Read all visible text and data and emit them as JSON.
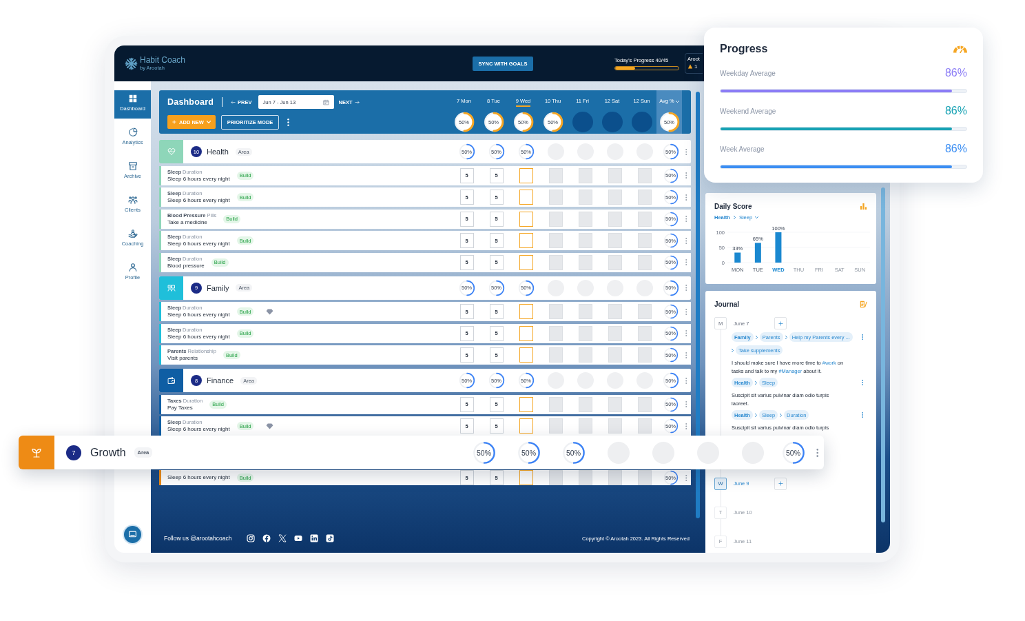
{
  "topbar": {
    "app_name": "Habit Coach",
    "byline": "by Arootah",
    "sync_button": "SYNC WITH GOALS",
    "today_progress": {
      "label": "Today’s Progress 40/45",
      "level": 0.32
    },
    "user": {
      "name": "Aroot",
      "count": "1"
    }
  },
  "sidebar": {
    "items": [
      {
        "label": "Dashboard",
        "selected": true
      },
      {
        "label": "Analytics",
        "selected": false
      },
      {
        "label": "Archive",
        "selected": false
      },
      {
        "label": "Clients",
        "selected": false
      },
      {
        "label": "Coaching",
        "selected": false
      },
      {
        "label": "Profile",
        "selected": false
      }
    ]
  },
  "board": {
    "title": "Dashboard",
    "prev": "PREV",
    "date_range": "Jun 7 - Jun 13",
    "next": "NEXT",
    "add_button": "ADD NEW",
    "mode_button": "PRIORITIZE MODE",
    "days": [
      {
        "label": "7 Mon",
        "selected": false,
        "future": false,
        "ring": {
          "label": "50%",
          "level": 0.5
        }
      },
      {
        "label": "8 Tue",
        "selected": false,
        "future": false,
        "ring": {
          "label": "50%",
          "level": 0.5
        }
      },
      {
        "label": "9 Wed",
        "selected": true,
        "future": false,
        "ring": {
          "label": "50%",
          "level": 0.5
        }
      },
      {
        "label": "10 Thu",
        "selected": false,
        "future": false,
        "ring": {
          "label": "50%",
          "level": 0.5
        }
      },
      {
        "label": "11 Fri",
        "selected": false,
        "future": true
      },
      {
        "label": "12 Sat",
        "selected": false,
        "future": true
      },
      {
        "label": "12 Sun",
        "selected": false,
        "future": true
      }
    ],
    "avg": {
      "label": "Avg %",
      "ring": {
        "label": "50%",
        "level": 0.5
      }
    }
  },
  "areas": [
    {
      "name": "Health",
      "count": "10",
      "tag": "Area",
      "color": "#8ed6b9",
      "popped_out": false,
      "rings": [
        {
          "label": "50%",
          "level": 0.5
        },
        {
          "label": "50%",
          "level": 0.5
        },
        {
          "label": "50%",
          "level": 0.5
        }
      ],
      "avg": {
        "label": "50%",
        "level": 0.5
      },
      "habits": [
        {
          "label": "**Sleep** Duration",
          "title": "Sleep 6 hours every night",
          "tag": "Build",
          "gem": false,
          "values": [
            "5",
            "5"
          ],
          "avg": {
            "label": "50%",
            "level": 0.5
          }
        },
        {
          "label": "**Sleep** Duration",
          "title": "Sleep 6 hours every night",
          "tag": "Build",
          "gem": false,
          "values": [
            "5",
            "5"
          ],
          "avg": {
            "label": "50%",
            "level": 0.5
          }
        },
        {
          "label": "**Blood Pressure** Pills",
          "title": "Take a medicine",
          "tag": "Build",
          "gem": false,
          "values": [
            "5",
            "5"
          ],
          "avg": {
            "label": "50%",
            "level": 0.5
          }
        },
        {
          "label": "**Sleep** Duration",
          "title": "Sleep 6 hours every night",
          "tag": "Build",
          "gem": false,
          "values": [
            "5",
            "5"
          ],
          "avg": {
            "label": "50%",
            "level": 0.5
          }
        },
        {
          "label": "**Sleep** Duration",
          "title": "Blood pressure",
          "tag": "Build",
          "gem": false,
          "values": [
            "5",
            "5"
          ],
          "avg": {
            "label": "50%",
            "level": 0.5
          }
        }
      ]
    },
    {
      "name": "Family",
      "count": "9",
      "tag": "Area",
      "color": "#1fbfda",
      "popped_out": false,
      "rings": [
        {
          "label": "50%",
          "level": 0.5
        },
        {
          "label": "50%",
          "level": 0.5
        },
        {
          "label": "50%",
          "level": 0.5
        }
      ],
      "avg": {
        "label": "50%",
        "level": 0.5
      },
      "habits": [
        {
          "label": "**Sleep** Duration",
          "title": "Sleep 6 hours every night",
          "tag": "Build",
          "gem": true,
          "values": [
            "5",
            "5"
          ],
          "avg": {
            "label": "50%",
            "level": 0.5
          }
        },
        {
          "label": "**Sleep** Duration",
          "title": "Sleep 6 hours every night",
          "tag": "Build",
          "gem": false,
          "values": [
            "5",
            "5"
          ],
          "avg": {
            "label": "50%",
            "level": 0.5
          }
        },
        {
          "label": "**Parents** Relationship",
          "title": "Visit parents",
          "tag": "Build",
          "gem": false,
          "values": [
            "5",
            "5"
          ],
          "avg": {
            "label": "50%",
            "level": 0.5
          }
        }
      ]
    },
    {
      "name": "Finance",
      "count": "8",
      "tag": "Area",
      "color": "#0f5ea4",
      "popped_out": false,
      "rings": [
        {
          "label": "50%",
          "level": 0.5
        },
        {
          "label": "50%",
          "level": 0.5
        },
        {
          "label": "50%",
          "level": 0.5
        }
      ],
      "avg": {
        "label": "50%",
        "level": 0.5
      },
      "habits": [
        {
          "label": "**Taxes** Duration",
          "title": "Pay Taxes",
          "tag": "Build",
          "gem": false,
          "values": [
            "5",
            "5"
          ],
          "avg": {
            "label": "50%",
            "level": 0.5
          }
        },
        {
          "label": "**Sleep** Duration",
          "title": "Sleep 6 hours every night",
          "tag": "Build",
          "gem": true,
          "values": [
            "5",
            "5"
          ],
          "avg": {
            "label": "50%",
            "level": 0.5
          }
        }
      ]
    },
    {
      "name": "Growth",
      "count": "7",
      "tag": "Area",
      "color": "#ee8b15",
      "popped_out": true,
      "rings": [
        {
          "label": "50%",
          "level": 0.5
        },
        {
          "label": "50%",
          "level": 0.5
        },
        {
          "label": "50%",
          "level": 0.5
        }
      ],
      "avg": {
        "label": "50%",
        "level": 0.5
      },
      "habits": [
        {
          "title": "Sleep 6 hours every night",
          "tag": "Build",
          "gem": false,
          "values": [
            "5",
            "5"
          ],
          "avg": {
            "label": "50%",
            "level": 0.5
          }
        }
      ]
    }
  ],
  "footer": {
    "follow": "Follow us @arootahcoach",
    "copyright": "Copyright © Arootah 2023. All Rights Reserved"
  },
  "progress": {
    "title": "Progress",
    "rows": [
      {
        "label": "Weekday Average",
        "value": "86%",
        "level": 0.94,
        "color": "#8b7cf6"
      },
      {
        "label": "Weekend Average",
        "value": "86%",
        "level": 0.94,
        "color": "#17a2b4"
      },
      {
        "label": "Week Average",
        "value": "86%",
        "level": 0.94,
        "color": "#3b8ef3"
      }
    ]
  },
  "daily_score": {
    "title": "Daily Score",
    "breadcrumb": [
      "Health",
      "Sleep"
    ],
    "chart_data": {
      "type": "bar",
      "categories": [
        "MON",
        "TUE",
        "WED",
        "THU",
        "FRI",
        "SAT",
        "SUN"
      ],
      "values": [
        33,
        65,
        100,
        null,
        null,
        null,
        null
      ],
      "ylim": [
        0,
        100
      ],
      "yticks": [
        0,
        50,
        100
      ],
      "value_labels": [
        "33%",
        "65%",
        "100%",
        null,
        null,
        null,
        null
      ]
    }
  },
  "journal": {
    "title": "Journal",
    "days": [
      {
        "badge": "M",
        "date": "June 7",
        "kind": "past",
        "notes": [
          {
            "path": [
              "Family",
              "Parents",
              "Help my Parents every ...",
              "Take supplements"
            ],
            "segments": [
              {
                "kind": "text",
                "text": "I should make sure I have more time to "
              },
              {
                "kind": "hashtag",
                "text": "#work"
              },
              {
                "kind": "text",
                "text": " on tasks and talk to my "
              },
              {
                "kind": "hashtag",
                "text": "#Manager"
              },
              {
                "kind": "text",
                "text": " about it."
              }
            ]
          },
          {
            "path": [
              "Health",
              "Sleep"
            ],
            "segments": [
              {
                "kind": "text",
                "text": "Suscipit sit varius pulvinar diam odio turpis laoreet."
              }
            ]
          },
          {
            "path": [
              "Health",
              "Sleep",
              "Duration"
            ],
            "segments": [
              {
                "kind": "text",
                "text": "Suscipit sit varius pulvinar diam odio turpis"
              }
            ]
          }
        ]
      },
      {
        "badge": "W",
        "date": "June 9",
        "kind": "today"
      },
      {
        "badge": "T",
        "date": "June 10",
        "kind": "future"
      },
      {
        "badge": "F",
        "date": "June 11",
        "kind": "future"
      }
    ]
  }
}
